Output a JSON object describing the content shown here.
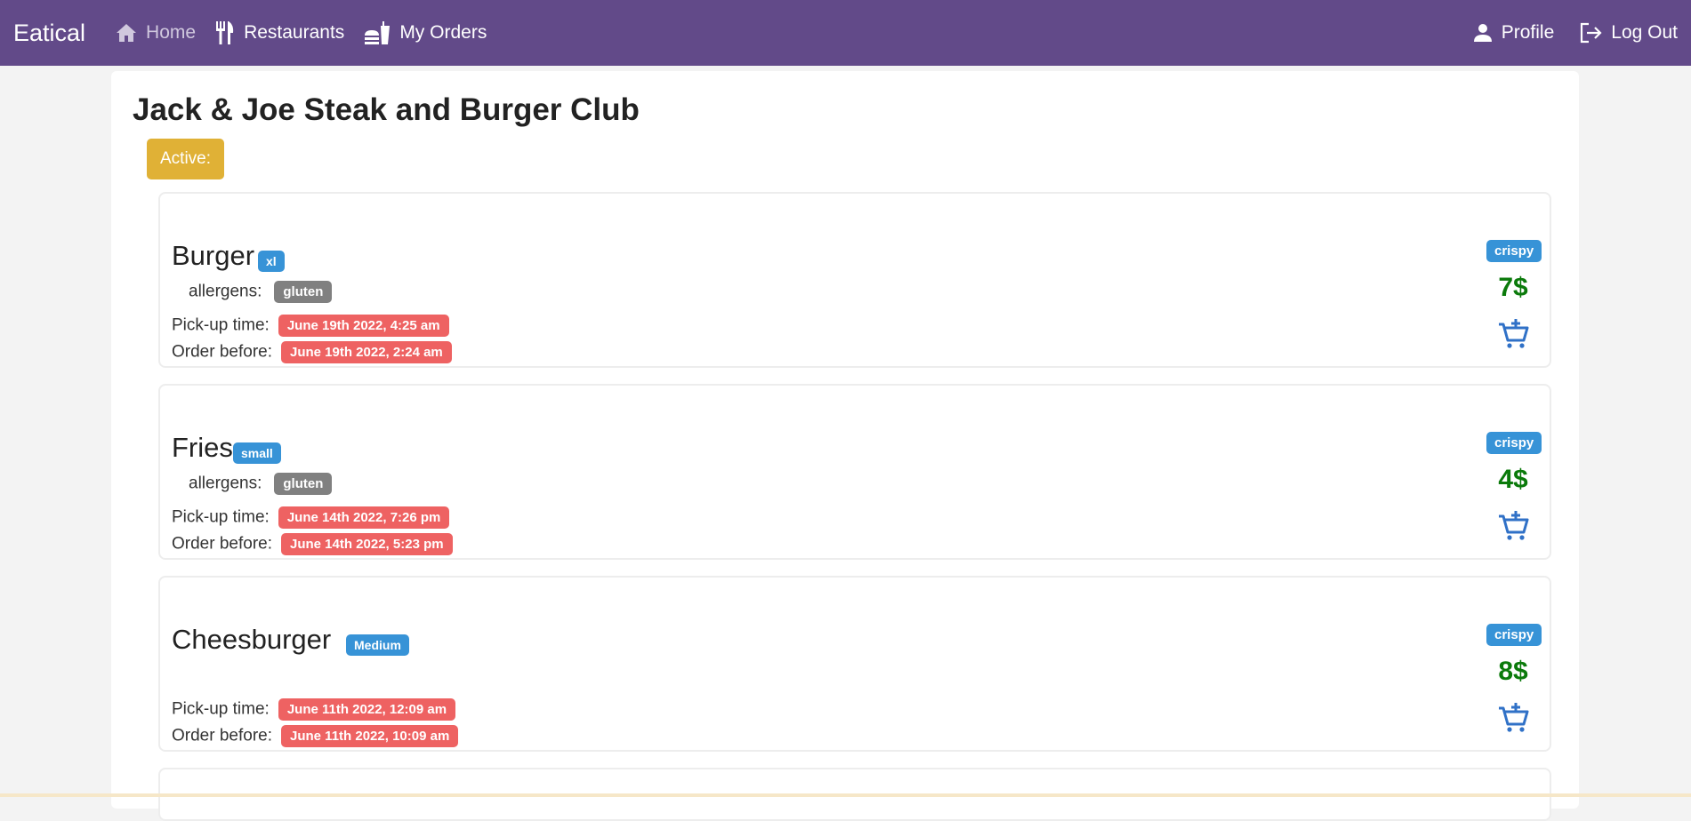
{
  "nav": {
    "brand": "Eatical",
    "home": "Home",
    "restaurants": "Restaurants",
    "my_orders": "My Orders",
    "profile": "Profile",
    "logout": "Log Out"
  },
  "restaurant": {
    "name": "Jack & Joe Steak and Burger Club",
    "status": "Active:"
  },
  "labels": {
    "allergens": "allergens:",
    "pickup": "Pick-up time:",
    "order_before": "Order before:"
  },
  "items": [
    {
      "name": "Burger",
      "size": "xl",
      "allergen": "gluten",
      "pickup": "June 19th 2022, 4:25 am",
      "order_before": "June 19th 2022, 2:24 am",
      "tag": "crispy",
      "price": "7$"
    },
    {
      "name": "Fries",
      "size": "small",
      "allergen": "gluten",
      "pickup": "June 14th 2022, 7:26 pm",
      "order_before": "June 14th 2022, 5:23 pm",
      "tag": "crispy",
      "price": "4$"
    },
    {
      "name": "Cheesburger",
      "size": "Medium",
      "allergen": "",
      "pickup": "June 11th 2022, 12:09 am",
      "order_before": "June 11th 2022, 10:09 am",
      "tag": "crispy",
      "price": "8$"
    }
  ],
  "colors": {
    "navbar": "#624a89",
    "status": "#e0b136",
    "size_badge": "#3793d7",
    "time_badge": "#ee6262",
    "allergen_badge": "#808080",
    "price": "#0b7a0b"
  }
}
